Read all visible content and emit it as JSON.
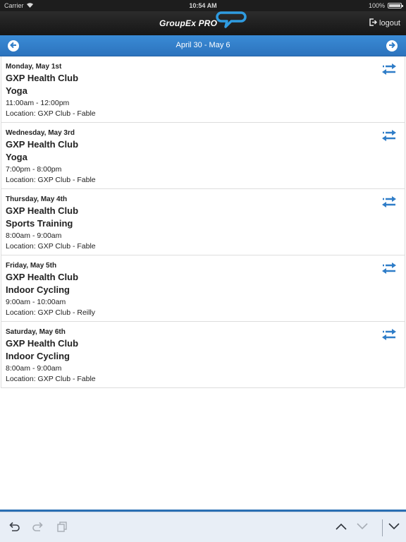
{
  "status_bar": {
    "carrier": "Carrier",
    "time": "10:54 AM",
    "battery": "100%"
  },
  "header": {
    "logo_text": "GroupEx PRO",
    "logout_label": "logout"
  },
  "nav": {
    "date_range": "April 30 - May 6"
  },
  "colors": {
    "accent_blue": "#2f7dc8",
    "header_dark": "#1d1d1d"
  },
  "sessions": [
    {
      "date": "Monday, May 1st",
      "club": "GXP Health Club",
      "class": "Yoga",
      "time": "11:00am - 12:00pm",
      "location": "Location: GXP Club - Fable"
    },
    {
      "date": "Wednesday, May 3rd",
      "club": "GXP Health Club",
      "class": "Yoga",
      "time": "7:00pm - 8:00pm",
      "location": "Location: GXP Club - Fable"
    },
    {
      "date": "Thursday, May 4th",
      "club": "GXP Health Club",
      "class": "Sports Training",
      "time": "8:00am - 9:00am",
      "location": "Location: GXP Club - Fable"
    },
    {
      "date": "Friday, May 5th",
      "club": "GXP Health Club",
      "class": "Indoor Cycling",
      "time": "9:00am - 10:00am",
      "location": "Location: GXP Club - Reilly"
    },
    {
      "date": "Saturday, May 6th",
      "club": "GXP Health Club",
      "class": "Indoor Cycling",
      "time": "8:00am - 9:00am",
      "location": "Location: GXP Club - Fable"
    }
  ],
  "icons": {
    "swap": "swap-icon",
    "prev": "arrow-left-circle-icon",
    "next": "arrow-right-circle-icon",
    "logout": "logout-icon",
    "undo": "undo-icon",
    "redo": "redo-icon",
    "copy": "copy-icon",
    "up": "chevron-up-icon",
    "down": "chevron-down-icon",
    "dismiss": "keyboard-dismiss-icon"
  }
}
